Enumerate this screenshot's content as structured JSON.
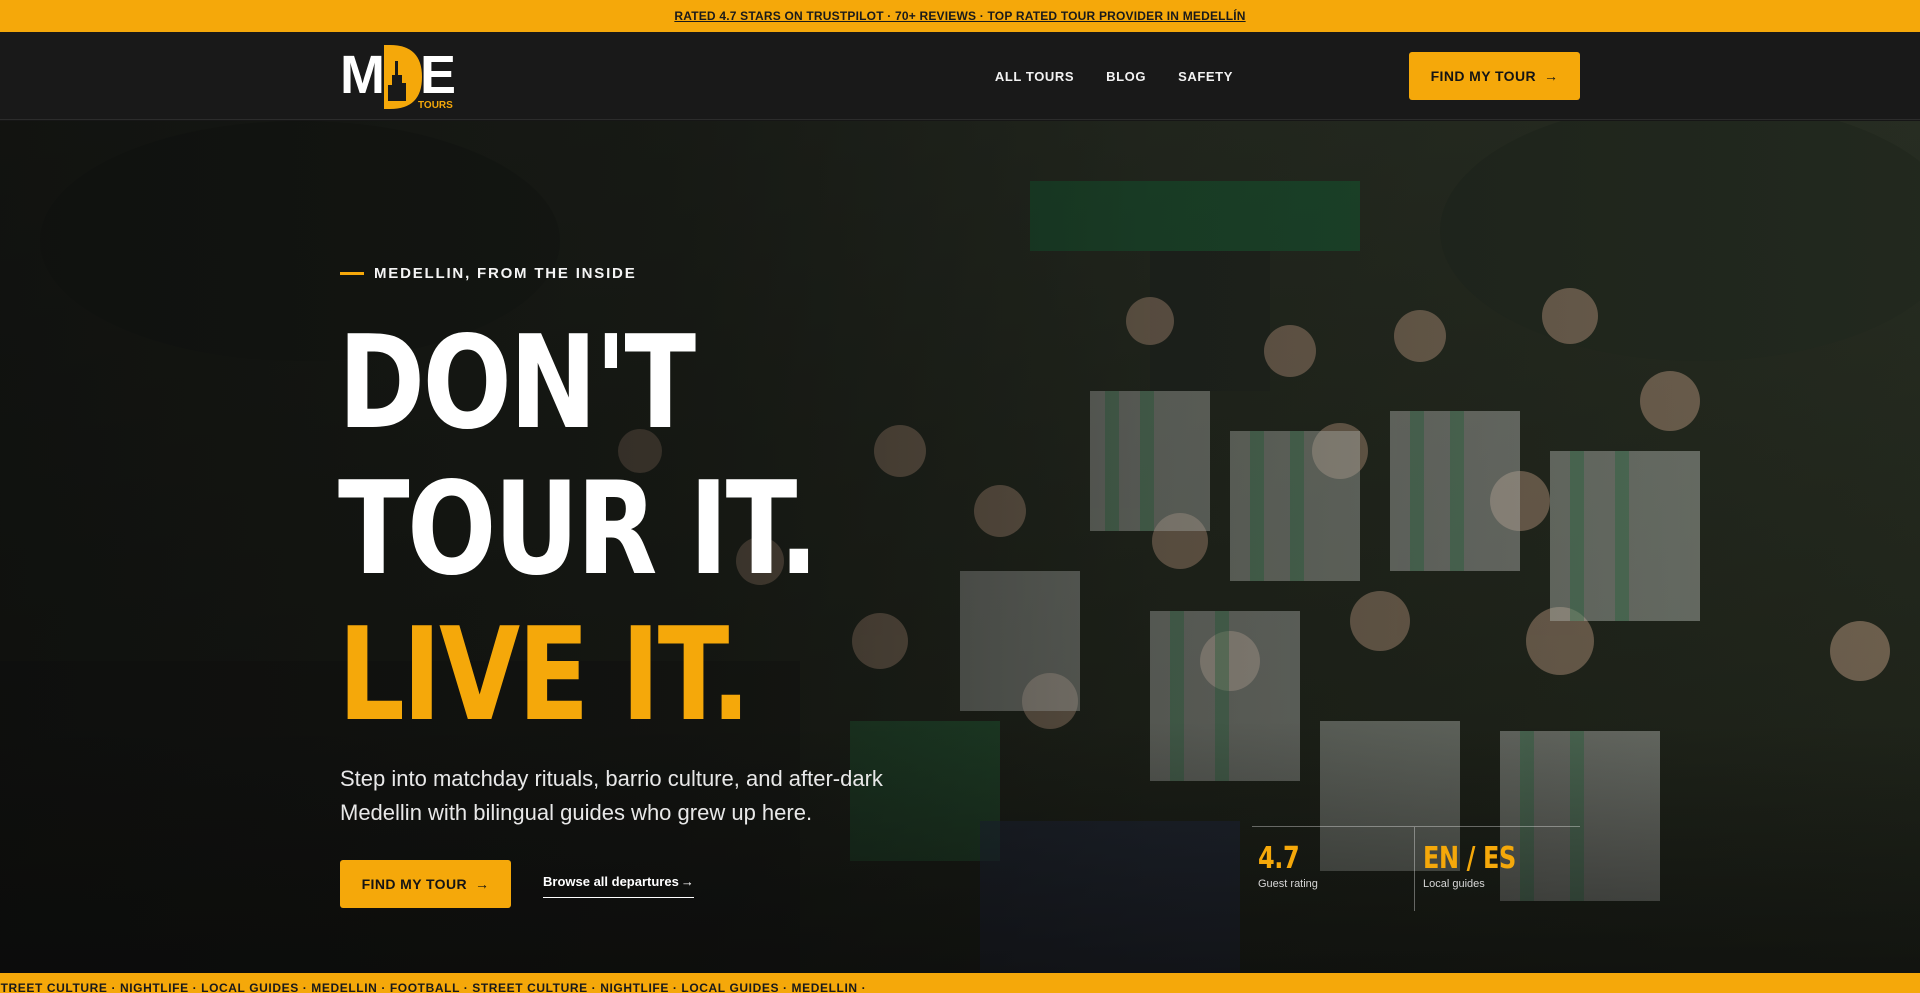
{
  "promo": {
    "text": "RATED 4.7 STARS ON TRUSTPILOT · 70+ REVIEWS · TOP RATED TOUR PROVIDER IN MEDELLÍN"
  },
  "nav": {
    "logo": {
      "main": "MDE",
      "sub": "TOURS"
    },
    "links": [
      "ALL TOURS",
      "BLOG",
      "SAFETY"
    ],
    "cta_label": "FIND MY TOUR",
    "cta_arrow": "→"
  },
  "hero": {
    "eyebrow": "MEDELLIN, FROM THE INSIDE",
    "headline_line1": "DON'T TOUR IT.",
    "headline_line2": "LIVE IT.",
    "subcopy": "Step into matchday rituals, barrio culture, and after-dark Medellin with bilingual guides who grew up here.",
    "cta_label": "FIND MY TOUR",
    "cta_arrow": "→",
    "browse_label": "Browse all departures",
    "browse_arrow": "→",
    "stats": [
      {
        "value": "4.7",
        "label": "Guest rating"
      },
      {
        "value": "EN / ES",
        "label": "Local guides"
      }
    ]
  },
  "ticker": {
    "text": "STREET CULTURE · NIGHTLIFE · LOCAL GUIDES · MEDELLIN · FOOTBALL · STREET CULTURE · NIGHTLIFE · LOCAL GUIDES · MEDELLIN ·"
  },
  "colors": {
    "accent": "#f5a80a",
    "nav_bg": "#191919",
    "text_dark": "#1a1a1a"
  }
}
